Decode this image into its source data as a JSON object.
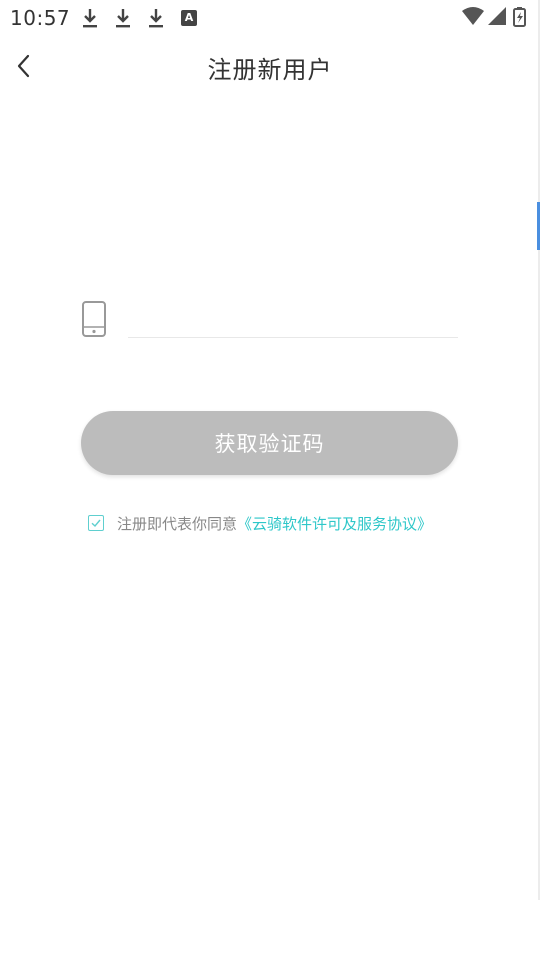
{
  "status_bar": {
    "time": "10:57",
    "notification_icons": [
      "download-icon",
      "download-icon",
      "download-icon",
      "a-icon"
    ],
    "a_icon_letter": "A",
    "right_icons": [
      "wifi-icon",
      "cell-signal-icon",
      "battery-charging-icon"
    ]
  },
  "header": {
    "title": "注册新用户",
    "back_icon": "chevron-left-icon"
  },
  "form": {
    "phone_icon": "phone-icon",
    "phone_placeholder": "",
    "phone_value": "",
    "get_code_label": "获取验证码"
  },
  "agreement": {
    "checked": true,
    "text": "注册即代表你同意",
    "link_text": "《云骑软件许可及服务协议》"
  },
  "colors": {
    "accent": "#2ec7c9",
    "button_bg": "#bcbcbc",
    "scroll_indicator": "#4a8fe0"
  }
}
